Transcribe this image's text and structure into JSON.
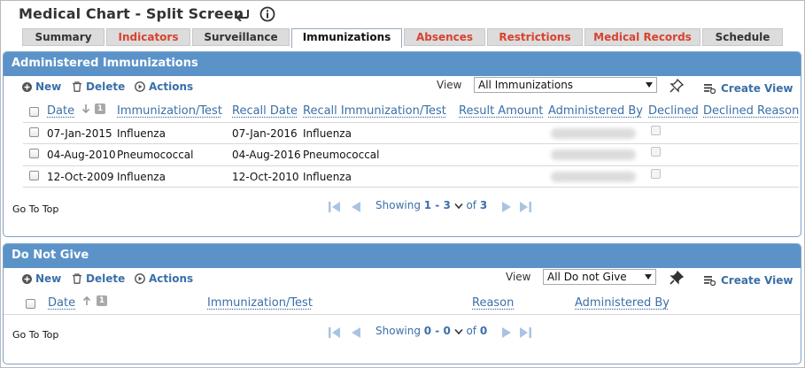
{
  "header": {
    "title": "Medical Chart - Split Screen"
  },
  "tabs": [
    {
      "label": "Summary"
    },
    {
      "label": "Indicators"
    },
    {
      "label": "Surveillance"
    },
    {
      "label": "Immunizations"
    },
    {
      "label": "Absences"
    },
    {
      "label": "Restrictions"
    },
    {
      "label": "Medical Records"
    },
    {
      "label": "Schedule"
    }
  ],
  "colors": {
    "accent": "#5b93c9",
    "link": "#3b6fa8",
    "tab_red": "#d9422f"
  },
  "administered": {
    "title": "Administered Immunizations",
    "toolbar": {
      "new": "New",
      "delete": "Delete",
      "actions": "Actions",
      "view_label": "View",
      "view_value": "All Immunizations",
      "create_view": "Create View"
    },
    "columns": [
      "Date",
      "Immunization/Test",
      "Recall Date",
      "Recall Immunization/Test",
      "Result Amount",
      "Administered By",
      "Declined",
      "Declined Reason"
    ],
    "sort_badge": "1",
    "rows": [
      {
        "date": "07-Jan-2015",
        "immunization": "Influenza",
        "recall_date": "07-Jan-2016",
        "recall_immunization": "Influenza"
      },
      {
        "date": "04-Aug-2010",
        "immunization": "Pneumococcal",
        "recall_date": "04-Aug-2016",
        "recall_immunization": "Pneumococcal"
      },
      {
        "date": "12-Oct-2009",
        "immunization": "Influenza",
        "recall_date": "12-Oct-2010",
        "recall_immunization": "Influenza"
      }
    ],
    "footer": {
      "go_to_top": "Go To Top",
      "showing": "Showing",
      "range": "1 - 3",
      "of": "of",
      "total": "3"
    }
  },
  "do_not_give": {
    "title": "Do Not Give",
    "toolbar": {
      "new": "New",
      "delete": "Delete",
      "actions": "Actions",
      "view_label": "View",
      "view_value": "All Do not Give",
      "create_view": "Create View"
    },
    "columns": [
      "Date",
      "Immunization/Test",
      "Reason",
      "Administered By"
    ],
    "sort_badge": "1",
    "footer": {
      "go_to_top": "Go To Top",
      "showing": "Showing",
      "range": "0 - 0",
      "of": "of",
      "total": "0"
    }
  }
}
